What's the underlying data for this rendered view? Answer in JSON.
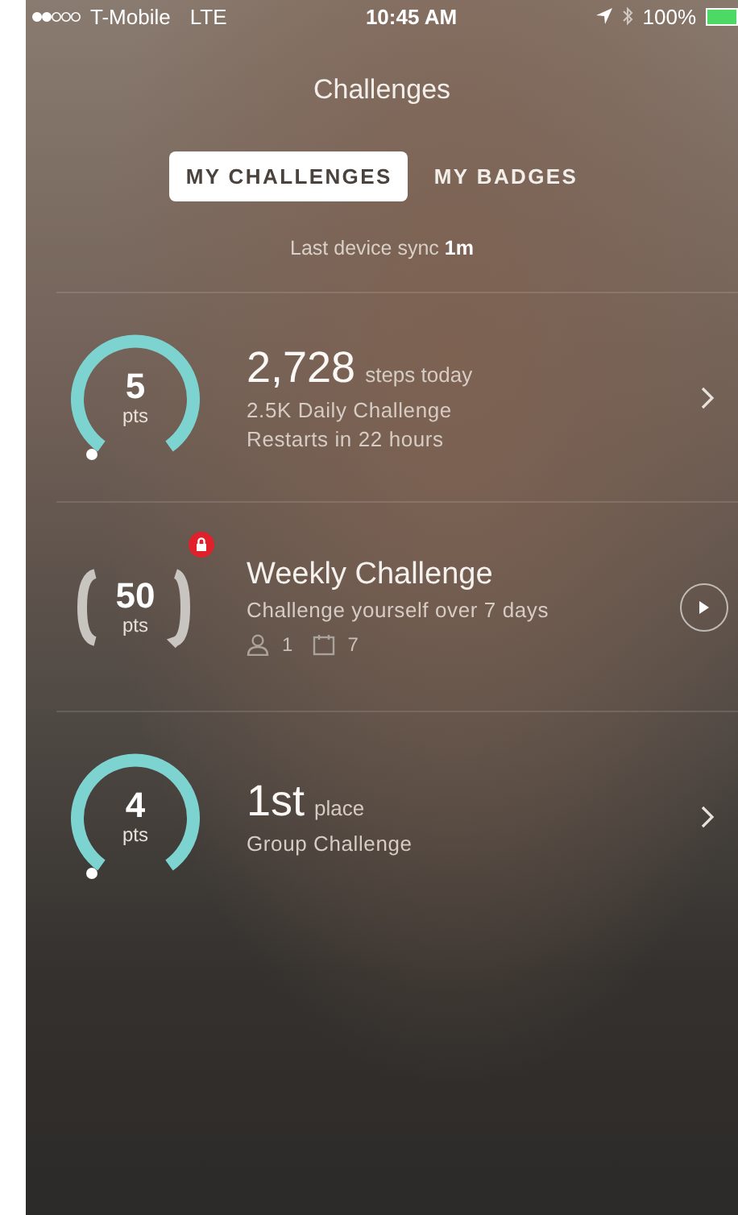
{
  "status_bar": {
    "carrier": "T-Mobile",
    "network": "LTE",
    "time": "10:45 AM",
    "battery": "100%"
  },
  "title": "Challenges",
  "tabs": [
    {
      "label": "MY CHALLENGES",
      "selected": true
    },
    {
      "label": "MY BADGES",
      "selected": false
    }
  ],
  "sync": "Last device sync **1m**",
  "challenges": [
    {
      "kind": "daily",
      "points": "5",
      "unit": "pts",
      "value": "2,728",
      "value_unit": "steps today",
      "lines": [
        "2.5K Daily Challenge",
        "Restarts in 22 hours"
      ]
    },
    {
      "kind": "weekly",
      "points": "50",
      "unit": "pts",
      "locked": true,
      "title": "Weekly Challenge",
      "subtitle": "Challenge yourself over 7 days",
      "participants": "1",
      "days": "7"
    },
    {
      "kind": "group",
      "points": "4",
      "unit": "pts",
      "value": "1st",
      "value_unit": "place",
      "lines": [
        "Group Challenge"
      ]
    }
  ]
}
